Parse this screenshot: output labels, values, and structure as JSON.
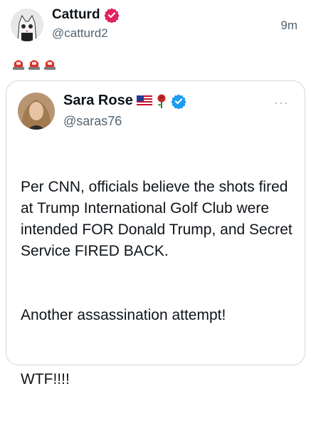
{
  "post": {
    "author_name": "Catturd",
    "author_handle": "@catturd2",
    "timestamp": "9m",
    "icons": [
      "cat-avatar",
      "verified-badge-icon",
      "siren-icon",
      "siren-icon",
      "siren-icon"
    ],
    "badge_color": "#e0245e"
  },
  "quote": {
    "author_name": "Sara Rose",
    "author_handle": "@saras76",
    "more_label": "···",
    "name_emojis": [
      "us-flag-icon",
      "rose-icon"
    ],
    "badge_color": "#1d9bf0",
    "body": [
      "Per CNN, officials believe the shots fired at Trump International Golf Club were intended FOR Donald Trump, and Secret Service FIRED BACK.",
      "Another assassination attempt!",
      "WTF!!!!"
    ]
  }
}
